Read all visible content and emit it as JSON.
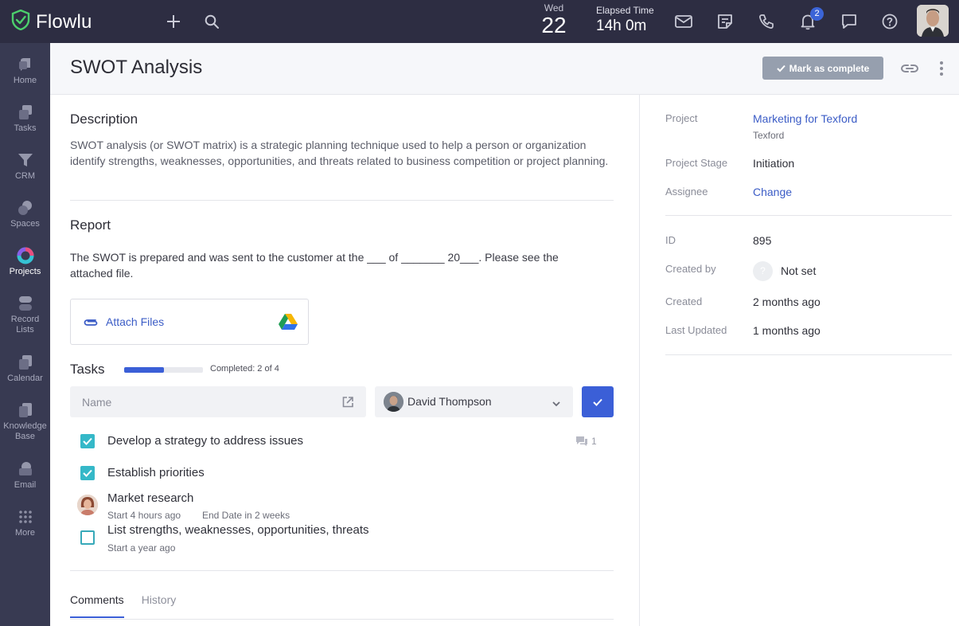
{
  "app": {
    "name": "Flowlu",
    "date_dow": "Wed",
    "date_day": "22",
    "elapsed_label": "Elapsed Time",
    "elapsed_value": "14h 0m",
    "notifications_count": "2",
    "accent": "#3b5fd7",
    "topbar_bg": "#2d2d42",
    "sidebar_bg": "#383a52"
  },
  "sidebar": {
    "items": [
      {
        "label": "Home",
        "icon": "home-icon"
      },
      {
        "label": "Tasks",
        "icon": "tasks-icon"
      },
      {
        "label": "CRM",
        "icon": "crm-funnel-icon"
      },
      {
        "label": "Spaces",
        "icon": "spaces-icon"
      },
      {
        "label": "Projects",
        "icon": "projects-icon"
      },
      {
        "label": "Record",
        "label2": "Lists",
        "icon": "record-lists-icon"
      },
      {
        "label": "Calendar",
        "icon": "calendar-icon"
      },
      {
        "label": "Knowledge",
        "label2": "Base",
        "icon": "knowledge-base-icon"
      },
      {
        "label": "Email",
        "icon": "email-icon"
      },
      {
        "label": "More",
        "icon": "grid-dots-icon"
      }
    ]
  },
  "header": {
    "title": "SWOT Analysis",
    "complete_label": "Mark as complete"
  },
  "description": {
    "title": "Description",
    "text": "SWOT analysis (or SWOT matrix) is a strategic planning technique used to help a person or organization identify strengths, weaknesses, opportunities, and threats related to business competition or project planning."
  },
  "report": {
    "title": "Report",
    "text": "The SWOT is prepared and was sent to the customer at the ___ of _______ 20___. Please see the attached file.",
    "attach_label": "Attach Files"
  },
  "tasks": {
    "title": "Tasks",
    "progress_completed": 2,
    "progress_total": 4,
    "progress_label": "Completed: 2 of 4",
    "name_placeholder": "Name",
    "assignee_name": "David Thompson",
    "items": [
      {
        "title": "Develop a strategy to address issues",
        "done": true,
        "comments": "1"
      },
      {
        "title": "Establish priorities",
        "done": true
      },
      {
        "title": "Market research",
        "start": "Start 4 hours ago",
        "end": "End Date in 2 weeks"
      },
      {
        "title": "List strengths, weaknesses, opportunities, threats",
        "done": false,
        "start": "Start a year ago"
      }
    ]
  },
  "tabs": [
    {
      "label": "Comments",
      "active": true
    },
    {
      "label": "History",
      "active": false
    }
  ],
  "details": {
    "project_label": "Project",
    "project_value": "Marketing for Texford",
    "project_sub": "Texford",
    "stage_label": "Project Stage",
    "stage_value": "Initiation",
    "assignee_label": "Assignee",
    "assignee_value": "Change",
    "id_label": "ID",
    "id_value": "895",
    "created_by_label": "Created by",
    "created_by_value": "Not set",
    "created_by_icon": "?",
    "created_label": "Created",
    "created_value": "2 months ago",
    "updated_label": "Last Updated",
    "updated_value": "1 months ago"
  }
}
